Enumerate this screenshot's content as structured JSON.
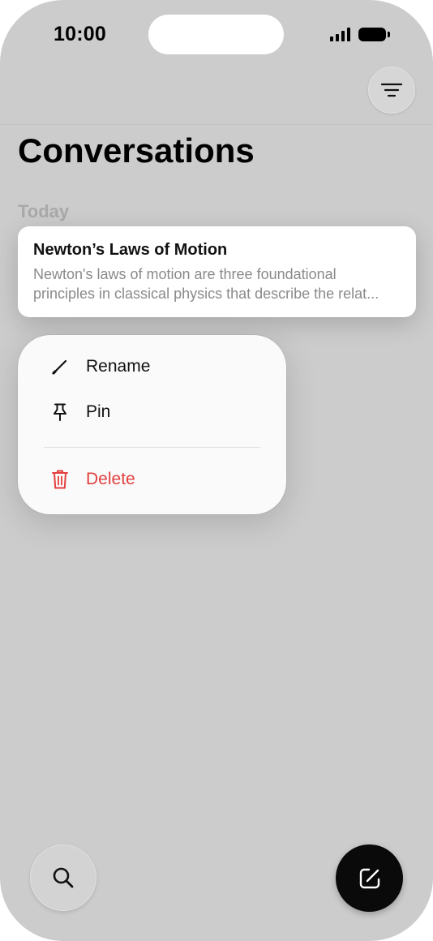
{
  "status_bar": {
    "time": "10:00"
  },
  "header": {
    "filter_icon": "filter-lines-icon"
  },
  "page": {
    "title": "Conversations"
  },
  "sections": [
    {
      "label": "Today",
      "conversations": [
        {
          "title": "Newton’s Laws of Motion",
          "preview_line1": "Newton's laws of motion are three foundational",
          "preview_line2": "principles in classical physics that describe the relat..."
        }
      ]
    }
  ],
  "context_menu": {
    "items": [
      {
        "label": "Rename",
        "icon": "pencil-icon"
      },
      {
        "label": "Pin",
        "icon": "pin-icon"
      },
      {
        "label": "Delete",
        "icon": "trash-icon",
        "color": "#e2403f"
      }
    ]
  },
  "bottom_bar": {
    "search_icon": "search-icon",
    "compose_icon": "compose-icon"
  },
  "colors": {
    "background": "#cccccc",
    "destructive": "#e2403f",
    "compose_button": "#0a0a0a"
  }
}
